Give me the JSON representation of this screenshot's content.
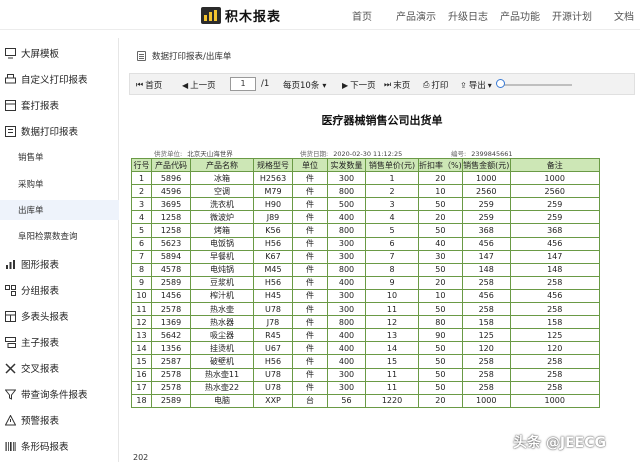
{
  "header": {
    "logo_text": "积木报表",
    "nav": [
      "首页",
      "产品演示",
      "升级日志",
      "产品功能",
      "开源计划",
      "文档"
    ]
  },
  "sidebar": {
    "items": [
      {
        "label": "大屏模板",
        "icon": "monitor-icon",
        "type": "group"
      },
      {
        "label": "自定义打印报表",
        "icon": "printer-icon",
        "type": "group"
      },
      {
        "label": "套打报表",
        "icon": "template-icon",
        "type": "group"
      },
      {
        "label": "数据打印报表",
        "icon": "data-icon",
        "type": "group"
      },
      {
        "label": "销售单",
        "type": "sub"
      },
      {
        "label": "采购单",
        "type": "sub"
      },
      {
        "label": "出库单",
        "type": "sub",
        "active": true
      },
      {
        "label": "阜阳检票数查询",
        "type": "sub"
      },
      {
        "label": "图形报表",
        "icon": "chart-icon",
        "type": "group"
      },
      {
        "label": "分组报表",
        "icon": "group-icon",
        "type": "group"
      },
      {
        "label": "多表头报表",
        "icon": "table-icon",
        "type": "group"
      },
      {
        "label": "主子报表",
        "icon": "master-detail-icon",
        "type": "group"
      },
      {
        "label": "交叉报表",
        "icon": "cross-icon",
        "type": "group"
      },
      {
        "label": "带查询条件报表",
        "icon": "filter-icon",
        "type": "group"
      },
      {
        "label": "预警报表",
        "icon": "alert-icon",
        "type": "group"
      },
      {
        "label": "条形码报表",
        "icon": "barcode-icon",
        "type": "group"
      }
    ]
  },
  "breadcrumb": "数据打印报表/出库单",
  "toolbar": {
    "first": "首页",
    "prev": "上一页",
    "page_value": "1",
    "page_total": "/1",
    "page_size": "每页10条",
    "next": "下一页",
    "last": "末页",
    "print": "打印",
    "export": "导出"
  },
  "report": {
    "title": "医疗器械销售公司出货单",
    "meta": [
      {
        "label": "供货单位:",
        "value": "北京天山海世界"
      },
      {
        "label": "供货日期:",
        "value": "2020-02-30 11:12:25"
      },
      {
        "label": "编号:",
        "value": "2399845661"
      }
    ],
    "columns": [
      "行号",
      "产品代码",
      "产品名称",
      "规格型号",
      "单位",
      "实发数量",
      "销售单价(元)",
      "折扣率（%)",
      "销售金额(元)",
      "备注"
    ],
    "rows": [
      [
        "1",
        "5896",
        "冰箱",
        "H2563",
        "件",
        "300",
        "1",
        "20",
        "1000",
        "1000"
      ],
      [
        "2",
        "4596",
        "空调",
        "M79",
        "件",
        "800",
        "2",
        "10",
        "2560",
        "2560"
      ],
      [
        "3",
        "3695",
        "洗衣机",
        "H90",
        "件",
        "500",
        "3",
        "50",
        "259",
        "259"
      ],
      [
        "4",
        "1258",
        "微波炉",
        "J89",
        "件",
        "400",
        "4",
        "20",
        "259",
        "259"
      ],
      [
        "5",
        "1258",
        "烤箱",
        "K56",
        "件",
        "800",
        "5",
        "50",
        "368",
        "368"
      ],
      [
        "6",
        "5623",
        "电饭锅",
        "H56",
        "件",
        "300",
        "6",
        "40",
        "456",
        "456"
      ],
      [
        "7",
        "5894",
        "早餐机",
        "K67",
        "件",
        "300",
        "7",
        "30",
        "147",
        "147"
      ],
      [
        "8",
        "4578",
        "电炖锅",
        "M45",
        "件",
        "800",
        "8",
        "50",
        "148",
        "148"
      ],
      [
        "9",
        "2589",
        "豆浆机",
        "H56",
        "件",
        "400",
        "9",
        "20",
        "258",
        "258"
      ],
      [
        "10",
        "1456",
        "榨汁机",
        "H45",
        "件",
        "300",
        "10",
        "10",
        "456",
        "456"
      ],
      [
        "11",
        "2578",
        "热水壶",
        "U78",
        "件",
        "300",
        "11",
        "50",
        "258",
        "258"
      ],
      [
        "12",
        "1369",
        "热水器",
        "J78",
        "件",
        "800",
        "12",
        "80",
        "158",
        "158"
      ],
      [
        "13",
        "5642",
        "吸尘器",
        "R45",
        "件",
        "400",
        "13",
        "90",
        "125",
        "125"
      ],
      [
        "14",
        "1356",
        "挂烫机",
        "U67",
        "件",
        "400",
        "14",
        "50",
        "120",
        "120"
      ],
      [
        "15",
        "2587",
        "破壁机",
        "H56",
        "件",
        "400",
        "15",
        "50",
        "258",
        "258"
      ],
      [
        "16",
        "2578",
        "热水壶11",
        "U78",
        "件",
        "300",
        "11",
        "50",
        "258",
        "258"
      ],
      [
        "17",
        "2578",
        "热水壶22",
        "U78",
        "件",
        "300",
        "11",
        "50",
        "258",
        "258"
      ],
      [
        "18",
        "2589",
        "电脑",
        "XXP",
        "台",
        "56",
        "1220",
        "20",
        "1000",
        "1000"
      ]
    ],
    "footer_number": "202"
  },
  "watermark": "头条 @JEECG",
  "colors": {
    "header_row": "#cde7b6",
    "grid_border": "#6a9a45",
    "accent": "#3a7bd5"
  }
}
